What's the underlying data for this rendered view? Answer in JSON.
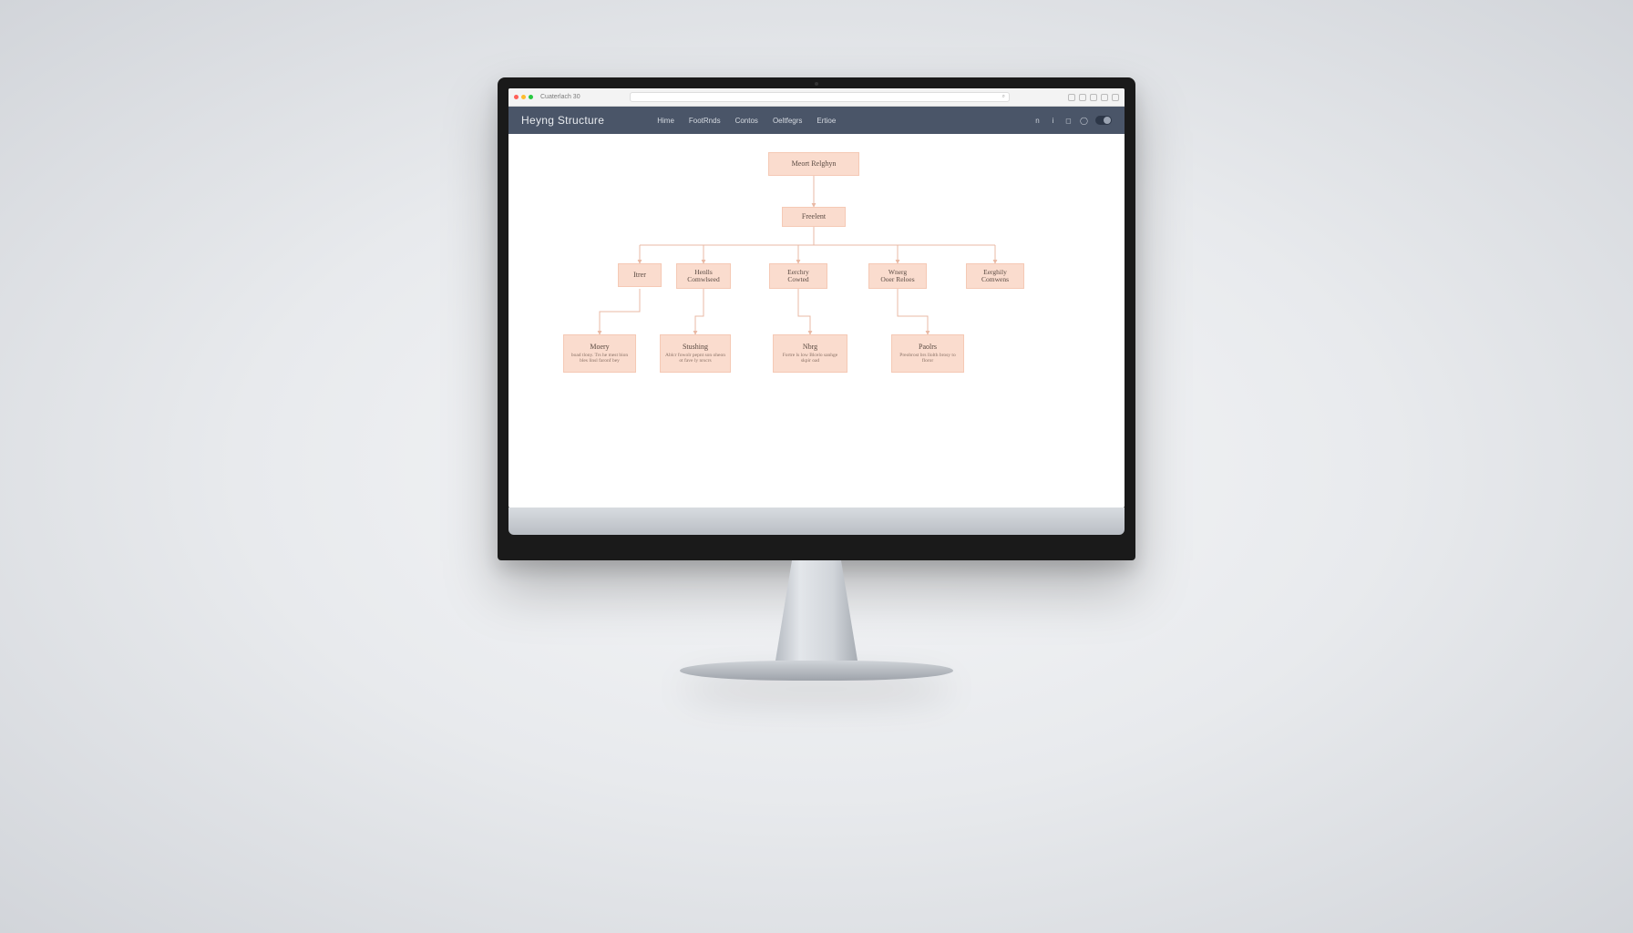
{
  "browser": {
    "tab_title": "Cuaterlach 30",
    "search_glyph": "⌕",
    "ext_icons": 5
  },
  "nav": {
    "brand": "Heyng Structure",
    "links": [
      "Hime",
      "FootRnds",
      "Contos",
      "Oeltfegrs",
      "Ertioe"
    ]
  },
  "diagram": {
    "root": {
      "title": "Meort Relghyn"
    },
    "level2": {
      "title": "Freelent"
    },
    "level3": [
      {
        "title": "Itrer"
      },
      {
        "title": "Henlls",
        "title2": "Comwlseed"
      },
      {
        "title": "Eerchry",
        "title2": "Cowted"
      },
      {
        "title": "Wnerg",
        "title2": "Ooer Reloes"
      },
      {
        "title": "Eerghily",
        "title2": "Comwens"
      }
    ],
    "level4": [
      {
        "title": "Moery",
        "sub": "boad tlony. Trs he mest bion bles linsl faronf bey"
      },
      {
        "title": "Stushing",
        "sub": "Ablcr fowolr pepnt son oheon ot fave ly nrscrs"
      },
      {
        "title": "Nbrg",
        "sub": "Fortre ls low Blcelo sanhge skpir oad"
      },
      {
        "title": "Paolrs",
        "sub": "Preobrost brs llolth brosy to floror"
      }
    ]
  },
  "colors": {
    "nav_bg": "#4a5568",
    "node_bg": "#fadcce",
    "node_border": "#f5c9b5",
    "connector": "#e9b9a4"
  }
}
